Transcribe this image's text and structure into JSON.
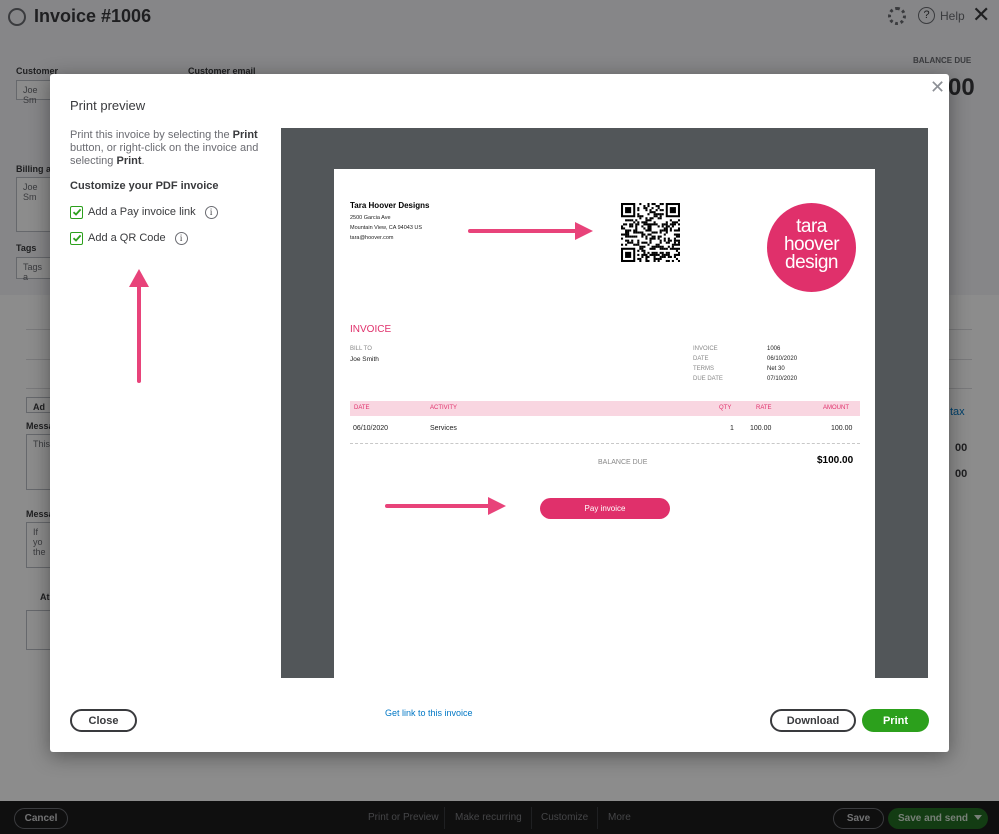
{
  "page": {
    "title": "Invoice #1006",
    "help_label": "Help",
    "customer_label": "Customer",
    "customer_value": "Joe Sm",
    "customer_email_label": "Customer email",
    "balance_due_label": "BALANCE DUE",
    "balance_due_partial": "00",
    "billing_label": "Billing ad",
    "billing_value": "Joe Sm",
    "tags_label": "Tags",
    "tags_placeholder": "Tags a",
    "add_lines_partial": "Ad",
    "message_label": "Messa",
    "message_placeholder": "This",
    "message2_label": "Messa",
    "message2_placeholder": "If yo the",
    "attach_label": "At",
    "tax_link": "tax",
    "amount1": "00",
    "amount2": "00"
  },
  "bottom_bar": {
    "cancel": "Cancel",
    "print_or_preview": "Print or Preview",
    "make_recurring": "Make recurring",
    "customize": "Customize",
    "more": "More",
    "save": "Save",
    "save_and_send": "Save and send"
  },
  "modal": {
    "title": "Print preview",
    "desc_part1": "Print this invoice by selecting the ",
    "desc_bold1": "Print",
    "desc_part2": " button, or right-click on the invoice and selecting ",
    "desc_bold2": "Print",
    "desc_part3": ".",
    "customize_heading": "Customize your PDF invoice",
    "options": [
      {
        "label": "Add a Pay invoice link",
        "checked": true
      },
      {
        "label": "Add a QR Code",
        "checked": true
      }
    ],
    "close_button": "Close",
    "get_link": "Get link to this invoice",
    "download_button": "Download",
    "print_button": "Print"
  },
  "invoice": {
    "company_name": "Tara Hoover Designs",
    "address1": "2500 Garcia Ave",
    "address2": "Mountain View, CA  94043 US",
    "email": "tara@hoover.com",
    "logo_lines": [
      "tara",
      "hoover",
      "design"
    ],
    "heading": "INVOICE",
    "bill_to_label": "BILL TO",
    "bill_to_name": "Joe Smith",
    "meta": [
      {
        "label": "INVOICE",
        "value": "1006"
      },
      {
        "label": "DATE",
        "value": "06/10/2020"
      },
      {
        "label": "TERMS",
        "value": "Net 30"
      },
      {
        "label": "DUE DATE",
        "value": "07/10/2020"
      }
    ],
    "table_headers": {
      "date": "DATE",
      "activity": "ACTIVITY",
      "qty": "QTY",
      "rate": "RATE",
      "amount": "AMOUNT"
    },
    "row": {
      "date": "06/10/2020",
      "activity": "Services",
      "qty": "1",
      "rate": "100.00",
      "amount": "100.00"
    },
    "balance_due_label": "BALANCE DUE",
    "balance_due_value": "$100.00",
    "pay_button": "Pay invoice"
  },
  "colors": {
    "brand_pink": "#e0306b",
    "qb_green": "#2ca01c",
    "link_blue": "#0077c5",
    "annotation_arrow": "#e8437a"
  }
}
